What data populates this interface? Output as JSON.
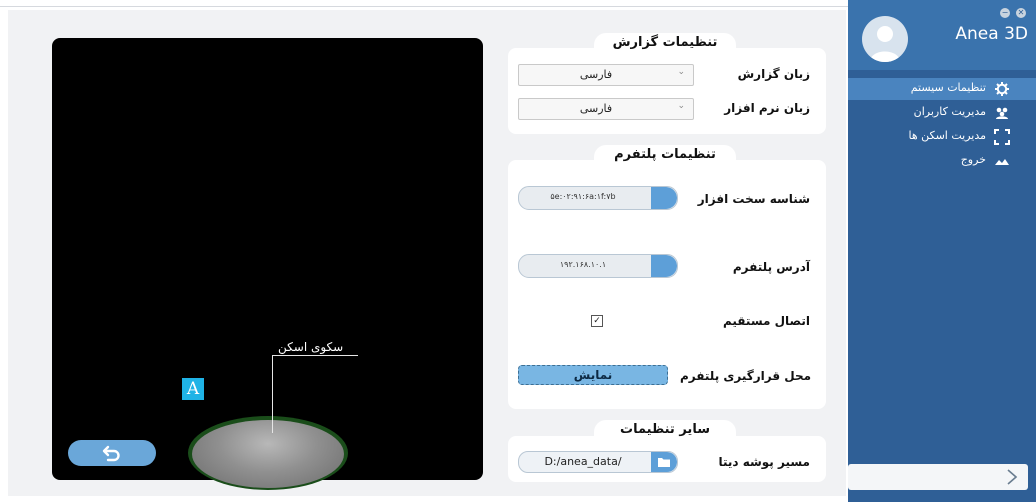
{
  "app": {
    "title": "Anea 3D"
  },
  "sidebar": {
    "items": [
      {
        "label": "تنظیمات سیستم",
        "icon": "gear-icon"
      },
      {
        "label": "مدیریت کاربران",
        "icon": "users-icon"
      },
      {
        "label": "مدیریت اسکن ها",
        "icon": "scan-frame-icon"
      },
      {
        "label": "خروج",
        "icon": "exit-icon"
      }
    ],
    "active_index": 0
  },
  "viewport": {
    "platform_label": "سکوی اسکن",
    "logo_letter": "A"
  },
  "report_settings": {
    "title": "تنظیمات گزارش",
    "report_language_label": "زبان گزارش",
    "report_language_value": "فارسی",
    "software_language_label": "زبان نرم افزار",
    "software_language_value": "فارسی"
  },
  "platform_settings": {
    "title": "تنظیمات پلتفرم",
    "hardware_id_label": "شناسه سخت افزار",
    "hardware_id_value": "۵e:۰۲:۹۱:۶a:۱f:۷b",
    "platform_address_label": "آدرس پلتفرم",
    "platform_address_value": "۱۹۲.۱۶۸.۱۰.۱",
    "direct_connection_label": "اتصال مستقیم",
    "direct_connection_checked": true,
    "platform_placement_label": "محل قرارگیری پلتفرم",
    "show_button_label": "نمایش"
  },
  "other_settings": {
    "title": "سایر تنظیمات",
    "data_folder_label": "مسیر پوشه دیتا",
    "data_folder_value": "D:/anea_data/"
  },
  "colors": {
    "sidebar": "#2f5f96",
    "accent": "#5d9fd8",
    "active_item": "#4a84bf"
  }
}
